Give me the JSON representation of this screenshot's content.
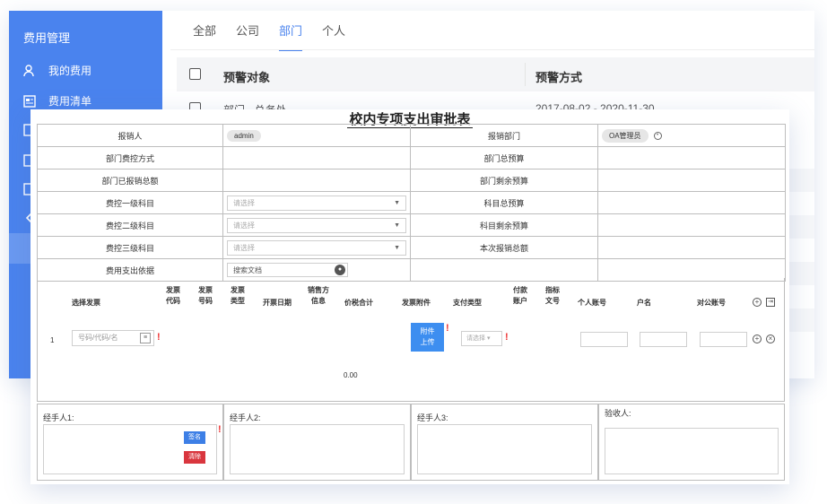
{
  "sidebar": {
    "title": "费用管理",
    "items": [
      {
        "label": "我的费用",
        "icon": "user-icon"
      },
      {
        "label": "费用清单",
        "icon": "list-icon"
      }
    ]
  },
  "tabs": [
    "全部",
    "公司",
    "部门",
    "个人"
  ],
  "active_tab": "部门",
  "table": {
    "headers": [
      "预警对象",
      "预警方式"
    ],
    "rows": [
      {
        "target": "部门 - 总务处",
        "method": "2017-08-02 - 2020-11-30"
      }
    ]
  },
  "form": {
    "title": "校内专项支出审批表",
    "rows": [
      {
        "l1": "报销人",
        "v1": "admin",
        "l2": "报销部门",
        "v2": "OA管理员"
      },
      {
        "l1": "部门费控方式",
        "l2": "部门总预算"
      },
      {
        "l1": "部门已报销总额",
        "l2": "部门剩余预算"
      },
      {
        "l1": "费控一级科目",
        "v1": "请选择",
        "l2": "科目总预算"
      },
      {
        "l1": "费控二级科目",
        "v1": "请选择",
        "l2": "科目剩余预算"
      },
      {
        "l1": "费控三级科目",
        "v1": "请选择",
        "l2": "本次报销总额"
      },
      {
        "l1": "费用支出依据",
        "v1": "搜索文档"
      }
    ],
    "invoice_headers": {
      "select": "选择发票",
      "code": "发票\n代码",
      "number": "发票\n号码",
      "type": "发票\n类型",
      "date": "开票日期",
      "seller": "销售方\n信息",
      "total": "价税合计",
      "attach": "发票附件",
      "pay_type": "支付类型",
      "pay_account": "付款\n账户",
      "index_doc": "指标\n文号",
      "personal": "个人账号",
      "account_name": "户名",
      "public_account": "对公账号"
    },
    "invoice_row": {
      "no": "1",
      "code_placeholder": "号码/代码/名",
      "attach_button": "附件\n上传",
      "pay_placeholder": "请选择"
    },
    "total_amount": "0.00",
    "signers": [
      "经手人1:",
      "经手人2:",
      "经手人3:",
      "验收人:"
    ],
    "sign_button": "签名",
    "clear_button": "清除"
  }
}
